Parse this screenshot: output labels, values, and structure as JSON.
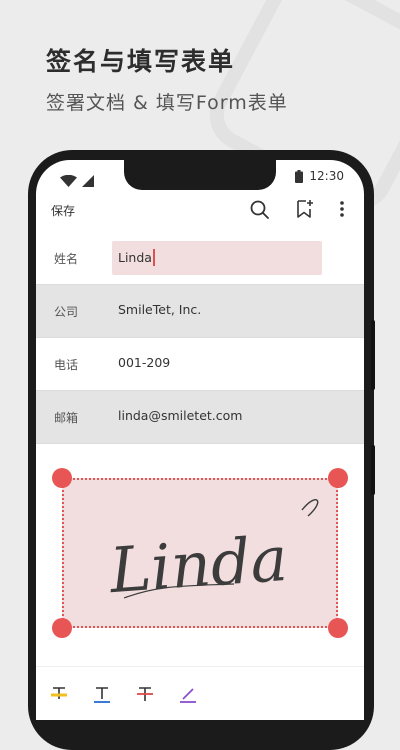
{
  "promo": {
    "title": "签名与填写表单",
    "subtitle": "签署文档 & 填写Form表单"
  },
  "status_bar": {
    "time": "12:30",
    "icons": [
      "wifi-icon",
      "signal-icon",
      "battery-icon"
    ]
  },
  "toolbar": {
    "save_label": "保存",
    "icons": [
      "search-icon",
      "bookmark-add-icon",
      "more-vertical-icon"
    ]
  },
  "form": {
    "fields": [
      {
        "label": "姓名",
        "value": "Linda",
        "active": true
      },
      {
        "label": "公司",
        "value": "SmileTet, Inc."
      },
      {
        "label": "电话",
        "value": "001-209"
      },
      {
        "label": "邮箱",
        "value": "linda@smiletet.com"
      }
    ]
  },
  "signature": {
    "text": "Linda",
    "box_color": "#f2dede",
    "border_color": "#e05555"
  },
  "bottom_tools": {
    "icons": [
      "text-underline-yellow-icon",
      "text-underline-blue-icon",
      "text-strikethrough-red-icon",
      "pen-purple-icon"
    ],
    "colors": [
      "#f0c020",
      "#3a7bd5",
      "#e04848",
      "#8a4fd0"
    ]
  },
  "colors": {
    "accent": "#e85555",
    "highlight": "#f2dede",
    "page_bg": "#ececec"
  }
}
